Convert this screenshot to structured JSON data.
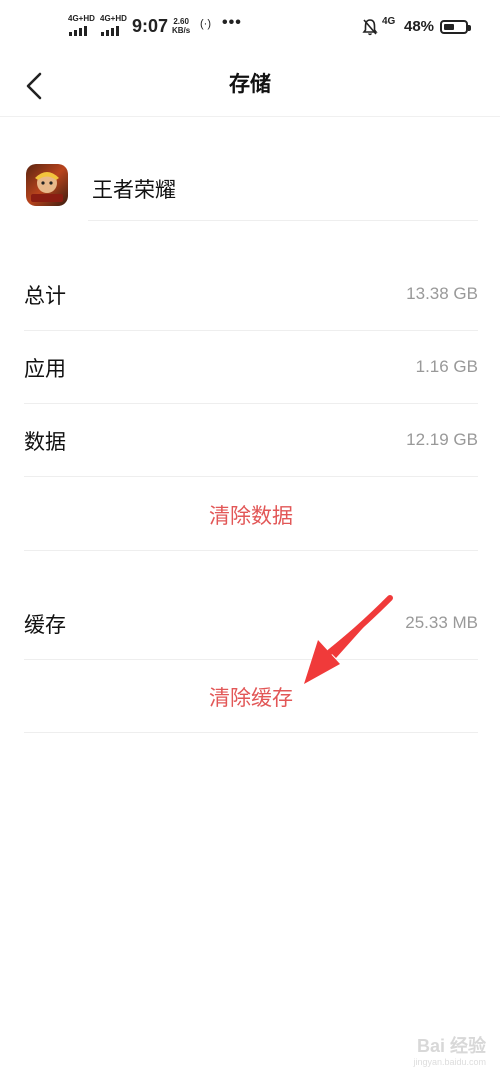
{
  "status_bar": {
    "signal1_label": "4G+HD",
    "signal2_label": "4G+HD",
    "time": "9:07",
    "speed_value": "2.60",
    "speed_unit": "KB/s",
    "hotspot_icon": "hotspot-icon",
    "more_dots": "•••",
    "mute_icon": "bell-off-icon",
    "network": "4G",
    "battery_percent": "48%",
    "battery_level": 0.48
  },
  "header": {
    "back_icon": "chevron-left-icon",
    "title": "存储"
  },
  "app": {
    "icon": "game-app-icon",
    "name": "王者荣耀"
  },
  "storage": {
    "rows": [
      {
        "label": "总计",
        "value": "13.38 GB"
      },
      {
        "label": "应用",
        "value": "1.16 GB"
      },
      {
        "label": "数据",
        "value": "12.19 GB"
      }
    ],
    "clear_data_label": "清除数据",
    "cache_label": "缓存",
    "cache_value": "25.33 MB",
    "clear_cache_label": "清除缓存"
  },
  "colors": {
    "accent_red": "#e25757",
    "annotation_arrow": "#f03a3a"
  },
  "watermark": {
    "brand": "Bai 经验",
    "url": "jingyan.baidu.com"
  }
}
